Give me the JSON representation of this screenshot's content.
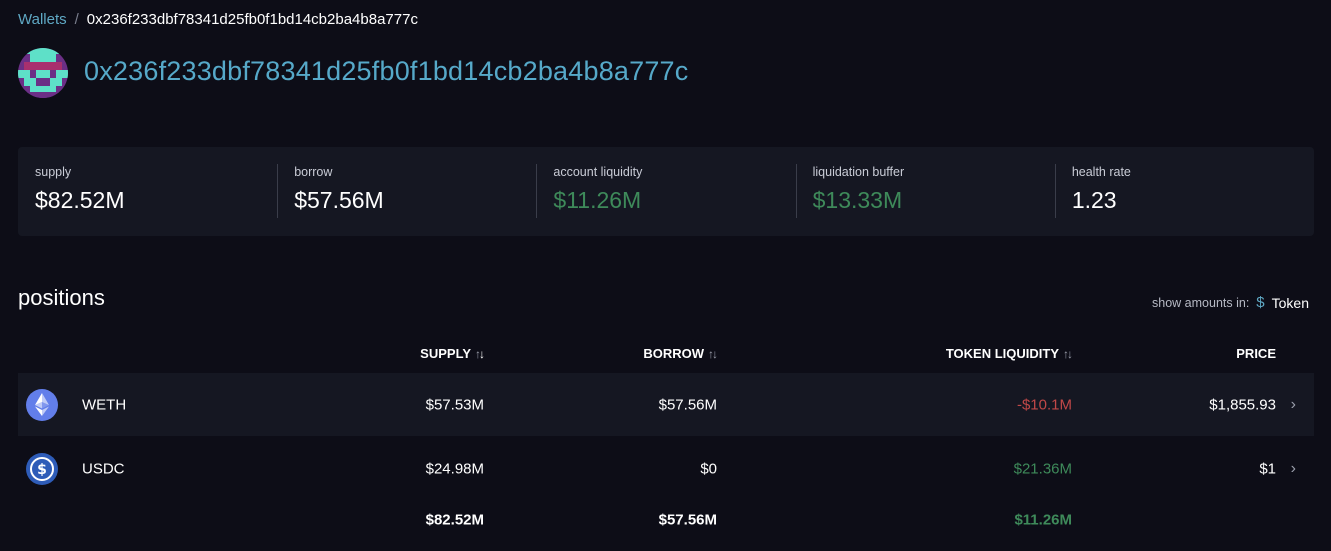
{
  "breadcrumb": {
    "root": "Wallets",
    "separator": "/",
    "current": "0x236f233dbf78341d25fb0f1bd14cb2ba4b8a777c"
  },
  "wallet": {
    "address": "0x236f233dbf78341d25fb0f1bd14cb2ba4b8a777c"
  },
  "stats": {
    "supply": {
      "label": "supply",
      "value": "$82.52M"
    },
    "borrow": {
      "label": "borrow",
      "value": "$57.56M"
    },
    "account_liquidity": {
      "label": "account liquidity",
      "value": "$11.26M"
    },
    "liquidation_buffer": {
      "label": "liquidation buffer",
      "value": "$13.33M"
    },
    "health_rate": {
      "label": "health rate",
      "value": "1.23"
    }
  },
  "positions": {
    "title": "positions",
    "amounts_label": "show amounts in:",
    "dollar_option": "$",
    "token_option": "Token",
    "columns": {
      "supply": "SUPPLY",
      "borrow": "BORROW",
      "token_liquidity": "TOKEN LIQUIDITY",
      "price": "PRICE"
    },
    "rows": [
      {
        "token": "WETH",
        "supply": "$57.53M",
        "borrow": "$57.56M",
        "liquidity": "-$10.1M",
        "price": "$1,855.93"
      },
      {
        "token": "USDC",
        "supply": "$24.98M",
        "borrow": "$0",
        "liquidity": "$21.36M",
        "price": "$1"
      }
    ],
    "totals": {
      "supply": "$82.52M",
      "borrow": "$57.56M",
      "liquidity": "$11.26M"
    }
  },
  "icons": {
    "weth": "ethereum-icon",
    "usdc": "usdc-icon",
    "chevron": "chevron-right-icon",
    "sort": "sort-arrows-icon"
  },
  "colors": {
    "background": "#0d0d17",
    "panel": "#151722",
    "accent": "#56a9c9",
    "positive": "#3e8a5a",
    "negative": "#c04848"
  }
}
